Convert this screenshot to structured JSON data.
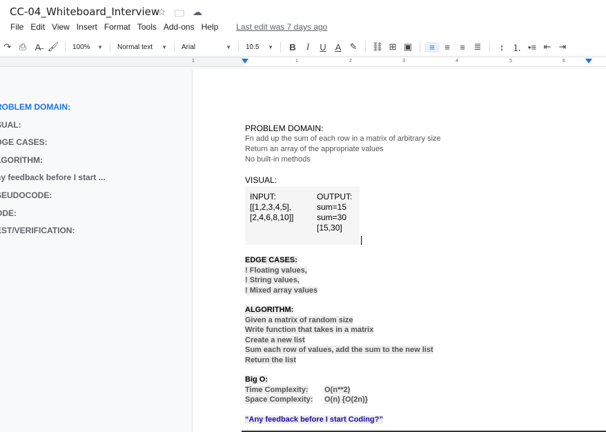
{
  "doc": {
    "title": "CC-04_Whiteboard_Interview"
  },
  "menu": [
    "File",
    "Edit",
    "View",
    "Insert",
    "Format",
    "Tools",
    "Add-ons",
    "Help"
  ],
  "last_edit": "Last edit was 7 days ago",
  "toolbar": {
    "zoom": "100%",
    "style": "Normal text",
    "font": "Arial",
    "size": "10.5"
  },
  "ruler": [
    "1",
    "1",
    "2",
    "3",
    "4",
    "5",
    "6"
  ],
  "outline": [
    "ROBLEM DOMAIN:",
    "SUAL:",
    "DGE CASES:",
    "LGORITHM:",
    "ny feedback before I start ...",
    "SEUDOCODE:",
    "ODE:",
    "EST/VERIFICATION:"
  ],
  "content": {
    "problem_heading": "PROBLEM DOMAIN:",
    "problem_lines": [
      "Fn add up the sum of each row in a matrix of arbitrary size",
      "Return an array of the appropriate values",
      "No built-in methods"
    ],
    "visual_heading": "VISUAL:",
    "input_lines": [
      "INPUT:",
      "[[1,2,3,4,5],",
      "[2,4,6,8,10]]"
    ],
    "output_lines": [
      "OUTPUT:",
      "sum=15",
      "sum=30",
      "[15,30]"
    ],
    "edge_heading": "EDGE CASES:",
    "edge_lines": [
      "! Floating values,",
      "! String values,",
      "! Mixed array values"
    ],
    "algo_heading": "ALGORITHM:",
    "algo_lines": [
      "Given a matrix of random size",
      "Write function that takes in a matrix",
      "Create a new list",
      "Sum each row of values, add the sum to the new list",
      "Return the list"
    ],
    "bigo_heading": "Big O:",
    "time_label": "Time Complexity:",
    "time_value": "O(n**2)",
    "space_label": "Space Complexity:",
    "space_value": "O(n) {O(2n)}",
    "quote": "“Any feedback before I start Coding?”"
  }
}
